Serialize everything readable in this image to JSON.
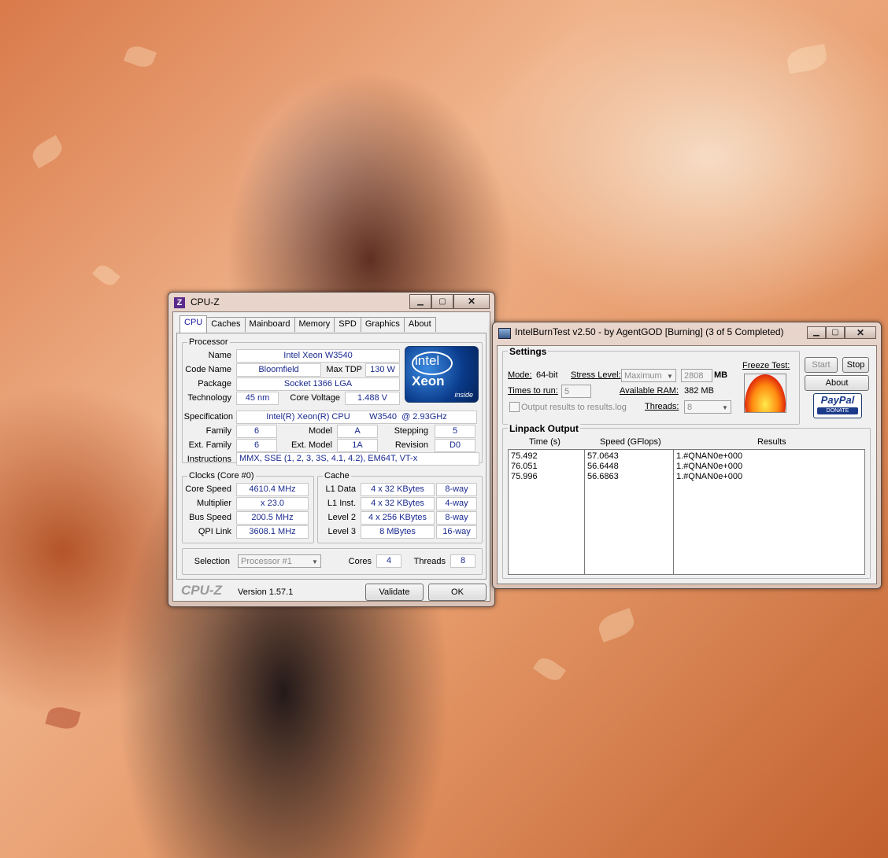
{
  "cpuz": {
    "window_title": "CPU-Z",
    "tabs": [
      "CPU",
      "Caches",
      "Mainboard",
      "Memory",
      "SPD",
      "Graphics",
      "About"
    ],
    "processor": {
      "group_title": "Processor",
      "name_label": "Name",
      "name": "Intel Xeon W3540",
      "code_name_label": "Code Name",
      "code_name": "Bloomfield",
      "max_tdp_label": "Max TDP",
      "max_tdp": "130 W",
      "package_label": "Package",
      "package": "Socket 1366 LGA",
      "technology_label": "Technology",
      "technology": "45 nm",
      "core_voltage_label": "Core Voltage",
      "core_voltage": "1.488 V",
      "specification_label": "Specification",
      "specification": "Intel(R) Xeon(R) CPU        W3540  @ 2.93GHz",
      "family_label": "Family",
      "family": "6",
      "model_label": "Model",
      "model": "A",
      "stepping_label": "Stepping",
      "stepping": "5",
      "ext_family_label": "Ext. Family",
      "ext_family": "6",
      "ext_model_label": "Ext. Model",
      "ext_model": "1A",
      "revision_label": "Revision",
      "revision": "D0",
      "instructions_label": "Instructions",
      "instructions": "MMX, SSE (1, 2, 3, 3S, 4.1, 4.2), EM64T, VT-x"
    },
    "logo": {
      "brand": "intel",
      "line": "Xeon",
      "tag": "inside"
    },
    "clocks": {
      "group_title": "Clocks (Core #0)",
      "core_speed_label": "Core Speed",
      "core_speed": "4610.4 MHz",
      "multiplier_label": "Multiplier",
      "multiplier": "x 23.0",
      "bus_speed_label": "Bus Speed",
      "bus_speed": "200.5 MHz",
      "qpi_link_label": "QPI Link",
      "qpi_link": "3608.1 MHz"
    },
    "cache": {
      "group_title": "Cache",
      "rows": [
        {
          "label": "L1 Data",
          "size": "4 x 32 KBytes",
          "ways": "8-way"
        },
        {
          "label": "L1 Inst.",
          "size": "4 x 32 KBytes",
          "ways": "4-way"
        },
        {
          "label": "Level 2",
          "size": "4 x 256 KBytes",
          "ways": "8-way"
        },
        {
          "label": "Level 3",
          "size": "8 MBytes",
          "ways": "16-way"
        }
      ]
    },
    "selection_label": "Selection",
    "selection_value": "Processor #1",
    "cores_label": "Cores",
    "cores": "4",
    "threads_label": "Threads",
    "threads": "8",
    "footer_brand": "CPU-Z",
    "version": "Version 1.57.1",
    "validate_label": "Validate",
    "ok_label": "OK"
  },
  "ibt": {
    "window_title": "IntelBurnTest v2.50 - by AgentGOD [Burning] (3 of 5 Completed)",
    "settings_title": "Settings",
    "mode_label": "Mode:",
    "mode_value": "64-bit",
    "stress_label": "Stress Level:",
    "stress_value": "Maximum",
    "mb_value": "2808",
    "mb_unit": "MB",
    "times_label": "Times to run:",
    "times_value": "5",
    "ram_label": "Available RAM:",
    "ram_value": "382 MB",
    "threads_label": "Threads:",
    "threads_value": "8",
    "output_checkbox_label": "Output results to results.log",
    "freeze_label": "Freeze Test:",
    "start_label": "Start",
    "stop_label": "Stop",
    "about_label": "About",
    "paypal_label": "PayPal",
    "donate_label": "DONATE",
    "linpack_title": "Linpack Output",
    "columns": [
      "Time (s)",
      "Speed (GFlops)",
      "Results"
    ],
    "rows": [
      [
        "75.492",
        "57.0643",
        "1.#QNAN0e+000"
      ],
      [
        "76.051",
        "56.6448",
        "1.#QNAN0e+000"
      ],
      [
        "75.996",
        "56.6863",
        "1.#QNAN0e+000"
      ]
    ]
  }
}
